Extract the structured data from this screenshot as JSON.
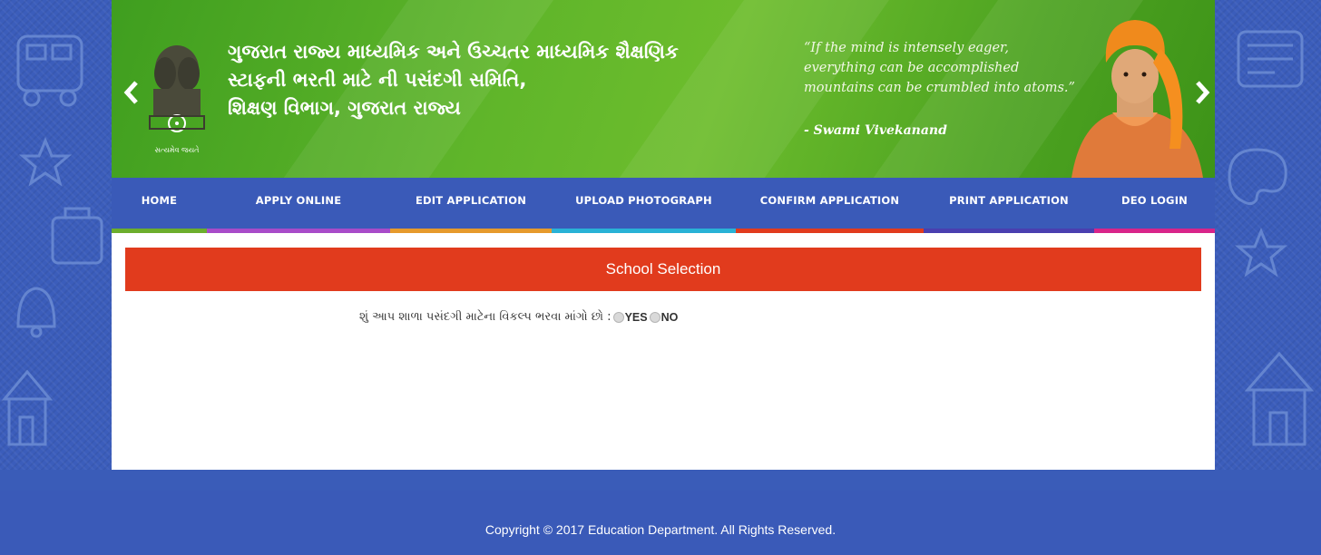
{
  "banner": {
    "title_lines": [
      "ગુજરાત રાજ્ય માધ્યમિક અને ઉચ્ચતર માધ્યમિક શૈક્ષણિક",
      "સ્ટાફની ભરતી માટે ની પસંદગી સમિતિ,",
      "શિક્ષણ વિભાગ, ગુજરાત રાજ્ય"
    ],
    "emblem_caption": "સત્યમેવ જયતે",
    "quote_lines": [
      "“If the mind is intensely eager,",
      "everything can be accomplished",
      "mountains can be crumbled into atoms.”"
    ],
    "quote_author": "- Swami Vivekanand"
  },
  "nav": {
    "items": [
      {
        "label": "HOME",
        "color": "#6cae2c"
      },
      {
        "label": "APPLY ONLINE",
        "color": "#a84bc9"
      },
      {
        "label": "EDIT APPLICATION",
        "color": "#e69a2c"
      },
      {
        "label": "UPLOAD PHOTOGRAPH",
        "color": "#29b2d6"
      },
      {
        "label": "CONFIRM APPLICATION",
        "color": "#e13b1d"
      },
      {
        "label": "PRINT APPLICATION",
        "color": "#4a3fb0"
      },
      {
        "label": "DEO LOGIN",
        "color": "#d8248a"
      }
    ]
  },
  "section": {
    "title": "School Selection"
  },
  "question": {
    "text": "શું આપ શાળા પસંદગી માટેના વિકલ્પ ભરવા માંગો છો :",
    "options": [
      "YES",
      "NO"
    ],
    "selected": null
  },
  "footer": {
    "text": "Copyright © 2017 Education Department. All Rights Reserved."
  },
  "colors": {
    "banner_green": "#5fb52a",
    "nav_blue": "#3a5ab8",
    "section_red": "#e13b1d"
  }
}
